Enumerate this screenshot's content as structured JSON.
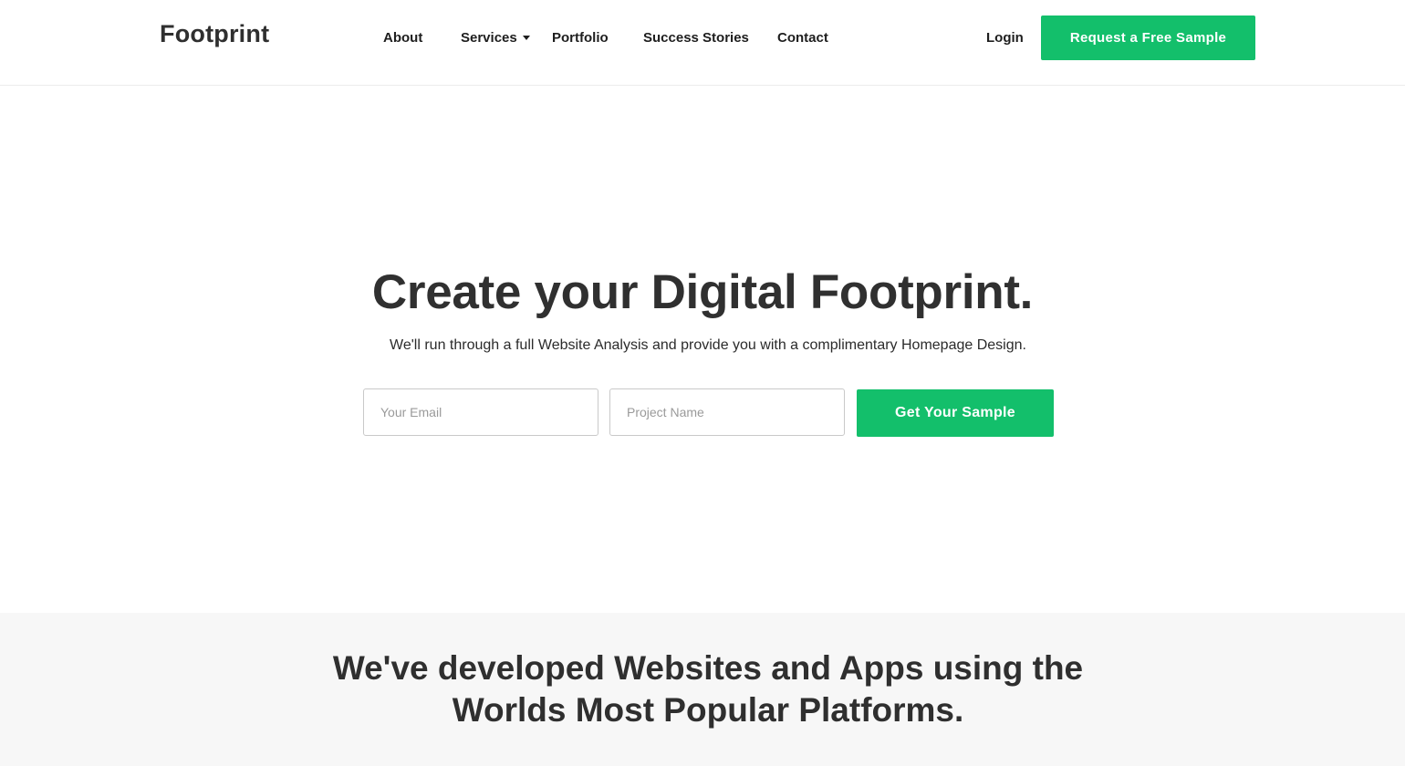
{
  "header": {
    "logo": "Footprint",
    "nav": [
      {
        "label": "About"
      },
      {
        "label": "Services",
        "has_dropdown": true
      },
      {
        "label": "Portfolio"
      },
      {
        "label": "Success Stories"
      },
      {
        "label": "Contact"
      }
    ],
    "login_label": "Login",
    "cta_label": "Request a Free Sample"
  },
  "hero": {
    "title": "Create your Digital Footprint.",
    "subtitle": "We'll run through a full Website Analysis and provide you with a complimentary Homepage Design.",
    "email_placeholder": "Your Email",
    "project_placeholder": "Project Name",
    "submit_label": "Get Your Sample"
  },
  "platforms": {
    "title_line1": "We've developed Websites and Apps using the",
    "title_line2": "Worlds Most Popular Platforms."
  },
  "colors": {
    "accent": "#13bf6b",
    "text": "#2f2f2f",
    "section_bg": "#f7f7f7"
  },
  "icons": {
    "services_dropdown": "caret-down-icon"
  }
}
